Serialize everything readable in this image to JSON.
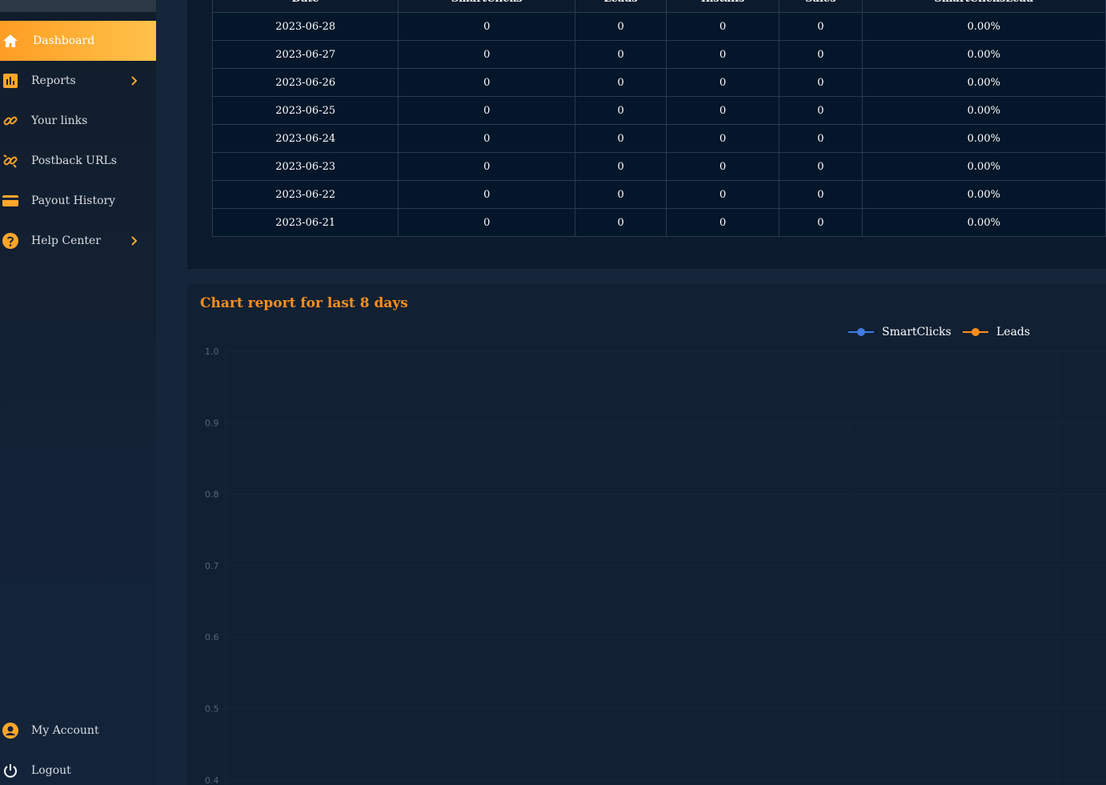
{
  "sidebar": {
    "items": [
      {
        "label": "Dashboard",
        "icon": "home-icon",
        "active": true
      },
      {
        "label": "Reports",
        "icon": "bar-chart-icon",
        "chevron": true
      },
      {
        "label": "Your links",
        "icon": "link-icon"
      },
      {
        "label": "Postback URLs",
        "icon": "broken-link-icon"
      },
      {
        "label": "Payout History",
        "icon": "credit-card-icon"
      },
      {
        "label": "Help Center",
        "icon": "help-icon",
        "chevron": true
      }
    ],
    "bottom": [
      {
        "label": "My Account",
        "icon": "user-icon"
      },
      {
        "label": "Logout",
        "icon": "power-icon"
      }
    ]
  },
  "table": {
    "headers": [
      "Date",
      "SmartClicks",
      "Leads",
      "Installs",
      "Sales",
      "SmartClicksLead"
    ],
    "rows": [
      [
        "2023-06-28",
        "0",
        "0",
        "0",
        "0",
        "0.00%"
      ],
      [
        "2023-06-27",
        "0",
        "0",
        "0",
        "0",
        "0.00%"
      ],
      [
        "2023-06-26",
        "0",
        "0",
        "0",
        "0",
        "0.00%"
      ],
      [
        "2023-06-25",
        "0",
        "0",
        "0",
        "0",
        "0.00%"
      ],
      [
        "2023-06-24",
        "0",
        "0",
        "0",
        "0",
        "0.00%"
      ],
      [
        "2023-06-23",
        "0",
        "0",
        "0",
        "0",
        "0.00%"
      ],
      [
        "2023-06-22",
        "0",
        "0",
        "0",
        "0",
        "0.00%"
      ],
      [
        "2023-06-21",
        "0",
        "0",
        "0",
        "0",
        "0.00%"
      ]
    ]
  },
  "chart_data": {
    "type": "line",
    "title": "Chart report for last 8 days",
    "series": [
      {
        "name": "SmartClicks",
        "color": "#3f7ae0",
        "values": []
      },
      {
        "name": "Leads",
        "color": "#ff8e1c",
        "values": []
      }
    ],
    "yticks": [
      "1.0",
      "0.9",
      "0.8",
      "0.7",
      "0.6",
      "0.5",
      "0.4"
    ],
    "ylim": [
      0.4,
      1.0
    ],
    "legend": "top-right"
  },
  "colors": {
    "accent": "#ff9d24",
    "title": "#ff8e1c"
  }
}
